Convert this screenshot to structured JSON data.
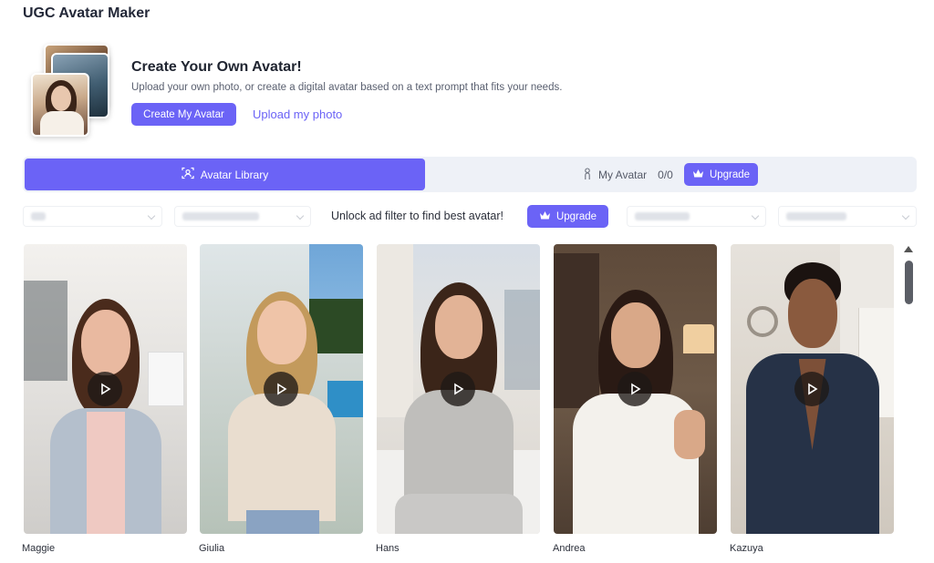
{
  "app": {
    "title": "UGC Avatar Maker"
  },
  "hero": {
    "heading": "Create Your Own Avatar!",
    "subtext": "Upload your own photo, or create a digital avatar based on a text prompt that fits your needs.",
    "create_button": "Create My Avatar",
    "upload_link": "Upload my photo"
  },
  "tabs": {
    "library_label": "Avatar Library",
    "my_avatar_label": "My Avatar",
    "my_avatar_count": "0/0",
    "upgrade_label": "Upgrade"
  },
  "filters": {
    "unlock_text": "Unlock ad filter to find best avatar!",
    "upgrade_label": "Upgrade"
  },
  "avatars": [
    {
      "name": "Maggie"
    },
    {
      "name": "Giulia"
    },
    {
      "name": "Hans"
    },
    {
      "name": "Andrea"
    },
    {
      "name": "Kazuya"
    }
  ],
  "colors": {
    "accent": "#6b63f6",
    "tabbar_bg": "#eef1f7"
  }
}
